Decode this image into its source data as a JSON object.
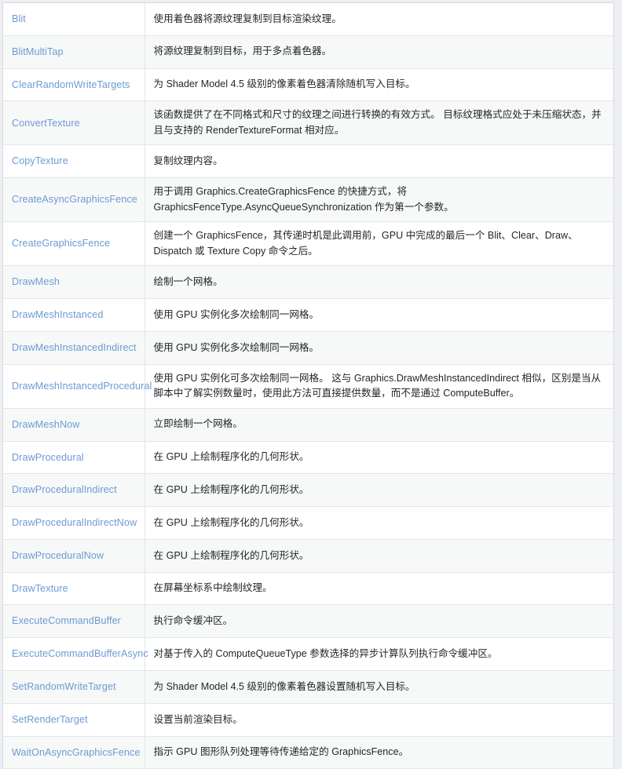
{
  "page": {
    "kind": "api-member-table",
    "accent_link_color": "#6c9bd2",
    "text_color": "#232629",
    "row_alt_color": "#f7f8f8",
    "row_color": "#ffffff",
    "border_color": "#e3e5e7",
    "page_background": "#edeff2"
  },
  "table": {
    "rows": [
      {
        "name": "Blit",
        "desc": "使用着色器将源纹理复制到目标渲染纹理。"
      },
      {
        "name": "BlitMultiTap",
        "desc": "将源纹理复制到目标，用于多点着色器。"
      },
      {
        "name": "ClearRandomWriteTargets",
        "desc": "为 Shader Model 4.5 级别的像素着色器清除随机写入目标。"
      },
      {
        "name": "ConvertTexture",
        "desc": "该函数提供了在不同格式和尺寸的纹理之间进行转换的有效方式。 目标纹理格式应处于未压缩状态，并且与支持的 RenderTextureFormat 相对应。"
      },
      {
        "name": "CopyTexture",
        "desc": "复制纹理内容。"
      },
      {
        "name": "CreateAsyncGraphicsFence",
        "desc": "用于调用 Graphics.CreateGraphicsFence 的快捷方式，将 GraphicsFenceType.AsyncQueueSynchronization 作为第一个参数。"
      },
      {
        "name": "CreateGraphicsFence",
        "desc": "创建一个 GraphicsFence，其传递时机是此调用前，GPU 中完成的最后一个 Blit、Clear、Draw、Dispatch 或 Texture Copy 命令之后。"
      },
      {
        "name": "DrawMesh",
        "desc": "绘制一个网格。"
      },
      {
        "name": "DrawMeshInstanced",
        "desc": "使用 GPU 实例化多次绘制同一网格。"
      },
      {
        "name": "DrawMeshInstancedIndirect",
        "desc": "使用 GPU 实例化多次绘制同一网格。"
      },
      {
        "name": "DrawMeshInstancedProcedural",
        "desc": "使用 GPU 实例化可多次绘制同一网格。 这与 Graphics.DrawMeshInstancedIndirect 相似，区别是当从脚本中了解实例数量时，使用此方法可直接提供数量，而不是通过 ComputeBuffer。"
      },
      {
        "name": "DrawMeshNow",
        "desc": "立即绘制一个网格。"
      },
      {
        "name": "DrawProcedural",
        "desc": "在 GPU 上绘制程序化的几何形状。"
      },
      {
        "name": "DrawProceduralIndirect",
        "desc": "在 GPU 上绘制程序化的几何形状。"
      },
      {
        "name": "DrawProceduralIndirectNow",
        "desc": "在 GPU 上绘制程序化的几何形状。"
      },
      {
        "name": "DrawProceduralNow",
        "desc": "在 GPU 上绘制程序化的几何形状。"
      },
      {
        "name": "DrawTexture",
        "desc": "在屏幕坐标系中绘制纹理。"
      },
      {
        "name": "ExecuteCommandBuffer",
        "desc": "执行命令缓冲区。"
      },
      {
        "name": "ExecuteCommandBufferAsync",
        "desc": "对基于传入的 ComputeQueueType 参数选择的异步计算队列执行命令缓冲区。"
      },
      {
        "name": "SetRandomWriteTarget",
        "desc": "为 Shader Model 4.5 级别的像素着色器设置随机写入目标。"
      },
      {
        "name": "SetRenderTarget",
        "desc": "设置当前渲染目标。"
      },
      {
        "name": "WaitOnAsyncGraphicsFence",
        "desc": "指示 GPU 图形队列处理等待传递给定的 GraphicsFence。"
      }
    ]
  }
}
